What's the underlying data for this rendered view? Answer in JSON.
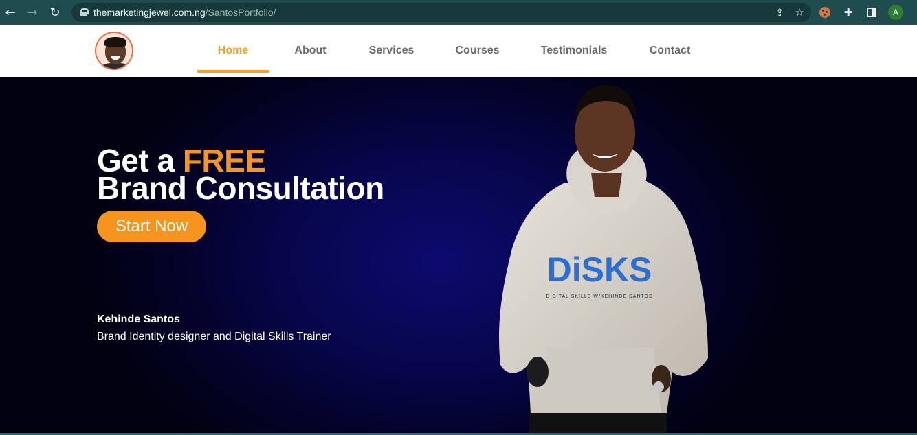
{
  "browser": {
    "url_host": "themarketingjewel.com.ng",
    "url_path": "/SantosPortfolio/",
    "profile_initial": "A",
    "icons": [
      "back-arrow-icon",
      "forward-arrow-icon",
      "reload-icon",
      "lock-icon",
      "share-icon",
      "star-icon",
      "cookie-extension-icon",
      "puzzle-extension-icon",
      "side-panel-icon",
      "profile-avatar",
      "menu-kebab-icon"
    ]
  },
  "nav": {
    "items": [
      {
        "label": "Home",
        "active": true
      },
      {
        "label": "About",
        "active": false
      },
      {
        "label": "Services",
        "active": false
      },
      {
        "label": "Courses",
        "active": false
      },
      {
        "label": "Testimonials",
        "active": false
      },
      {
        "label": "Contact",
        "active": false
      }
    ]
  },
  "hero": {
    "title_prefix": "Get a ",
    "title_accent": "FREE",
    "title_line2": "Brand Consultation",
    "cta_label": "Start Now",
    "name": "Kehinde Santos",
    "role": "Brand Identity designer and Digital Skills Trainer",
    "hoodie_logo": "DiSKS",
    "hoodie_tagline": "DIGITAL SKILLS W/KEHINDE SANTOS"
  },
  "colors": {
    "accent": "#f7941d",
    "nav_active": "#f7a21b",
    "hero_bg": "#07064a",
    "chrome_bg": "#1f4d4f"
  }
}
